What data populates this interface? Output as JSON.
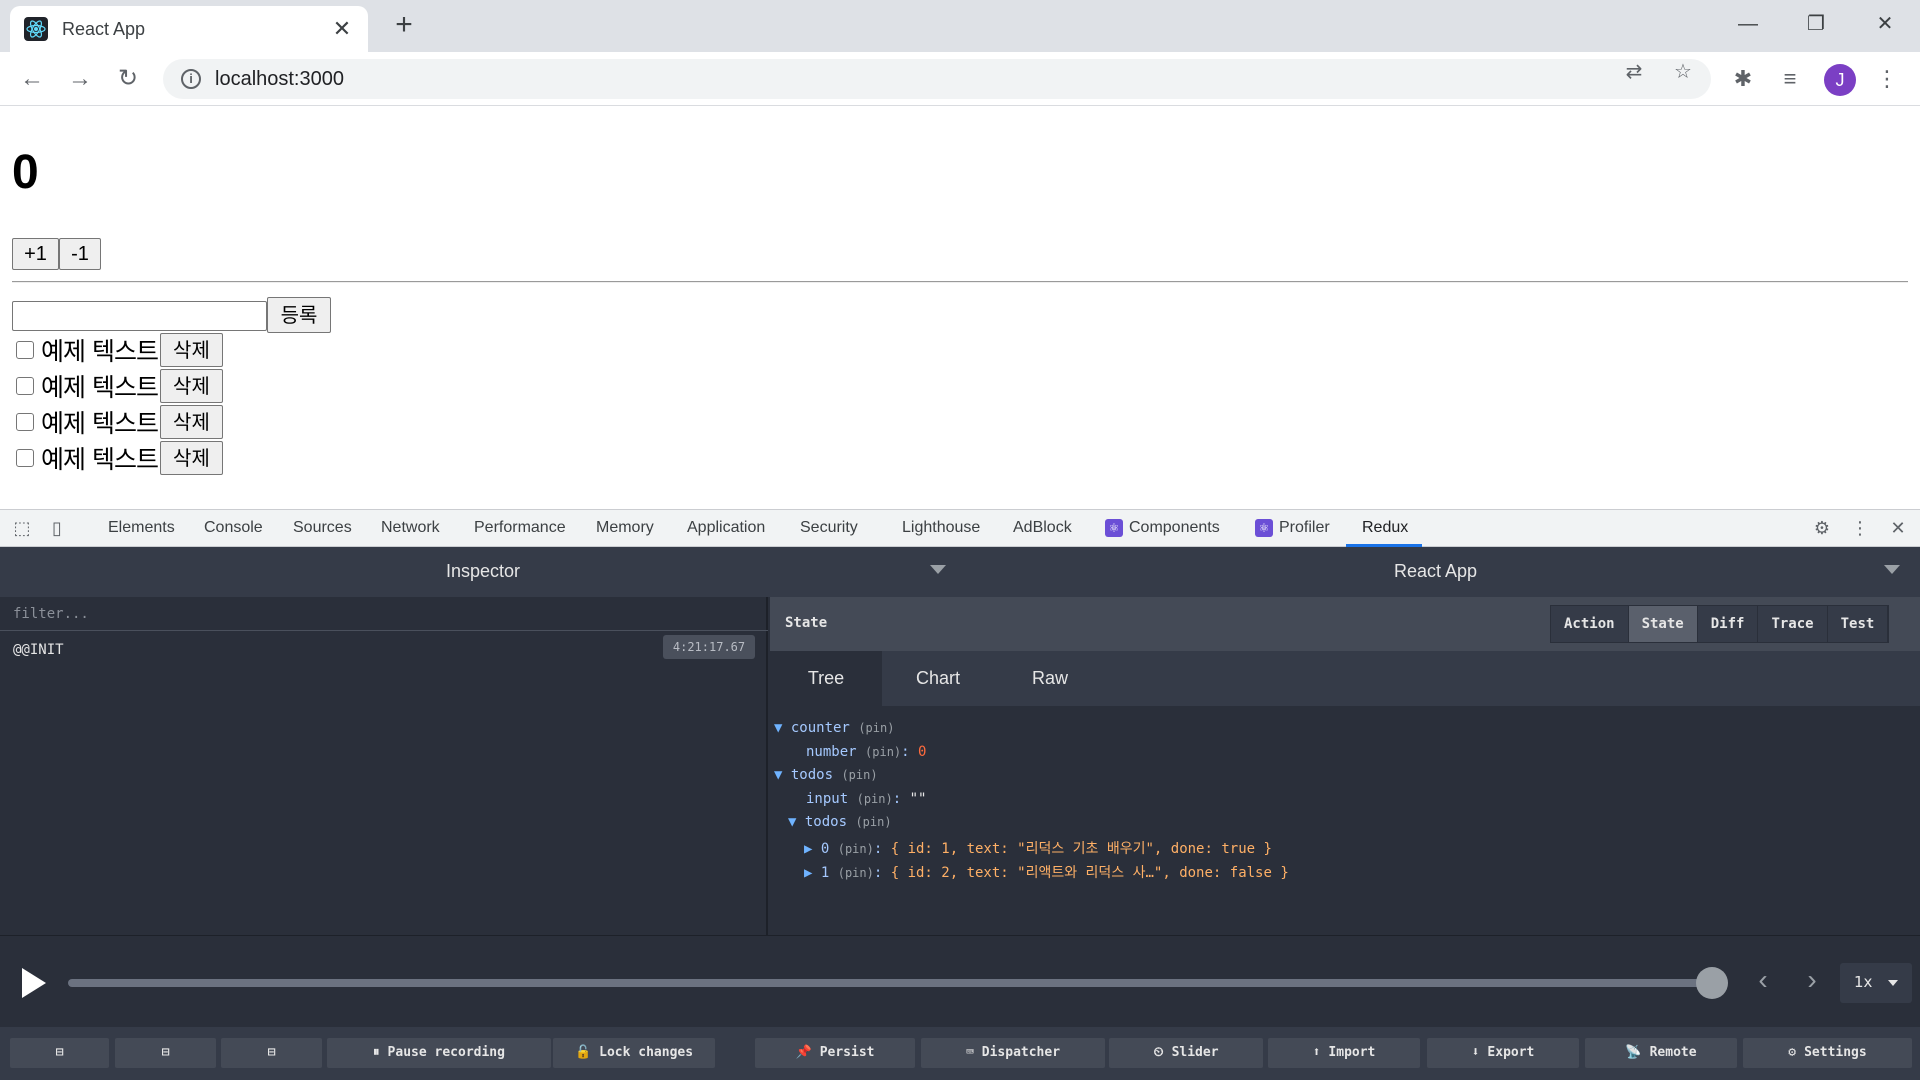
{
  "browser": {
    "tab_title": "React App",
    "url": "localhost:3000",
    "profile_initial": "J"
  },
  "page": {
    "counter_value": "0",
    "increment_label": "+1",
    "decrement_label": "-1",
    "input_value": "",
    "submit_label": "등록",
    "todos": [
      {
        "text": "예제 텍스트",
        "delete_label": "삭제",
        "checked": false
      },
      {
        "text": "예제 텍스트",
        "delete_label": "삭제",
        "checked": false
      },
      {
        "text": "예제 텍스트",
        "delete_label": "삭제",
        "checked": false
      },
      {
        "text": "예제 텍스트",
        "delete_label": "삭제",
        "checked": false
      }
    ]
  },
  "devtools": {
    "tabs": [
      "Elements",
      "Console",
      "Sources",
      "Network",
      "Performance",
      "Memory",
      "Application",
      "Security",
      "Lighthouse",
      "AdBlock",
      "Components",
      "Profiler",
      "Redux"
    ],
    "active_tab": "Redux"
  },
  "redux": {
    "inspector_label": "Inspector",
    "instance_label": "React App",
    "filter_placeholder": "filter...",
    "actions": [
      {
        "name": "@@INIT",
        "time": "4:21:17.67"
      }
    ],
    "state_label": "State",
    "monitor_tabs": [
      "Action",
      "State",
      "Diff",
      "Trace",
      "Test"
    ],
    "active_monitor_tab": "State",
    "sub_tabs": [
      "Tree",
      "Chart",
      "Raw"
    ],
    "active_sub_tab": "Tree",
    "tree": {
      "counter_key": "counter",
      "number_key": "number",
      "number_value": "0",
      "todos_key": "todos",
      "input_key": "input",
      "input_value": "\"\"",
      "todos_list_key": "todos",
      "item0_key": "0",
      "item0_value": "{ id: 1, text: \"리덕스 기초 배우기\", done: true }",
      "item1_key": "1",
      "item1_value": "{ id: 2, text: \"리액트와 리덕스 사…\", done: false }",
      "pin_label": "(pin)"
    },
    "speed": "1x",
    "bottom_buttons": [
      "Pause recording",
      "Lock changes",
      "Persist",
      "Dispatcher",
      "Slider",
      "Import",
      "Export",
      "Remote",
      "Settings"
    ]
  }
}
